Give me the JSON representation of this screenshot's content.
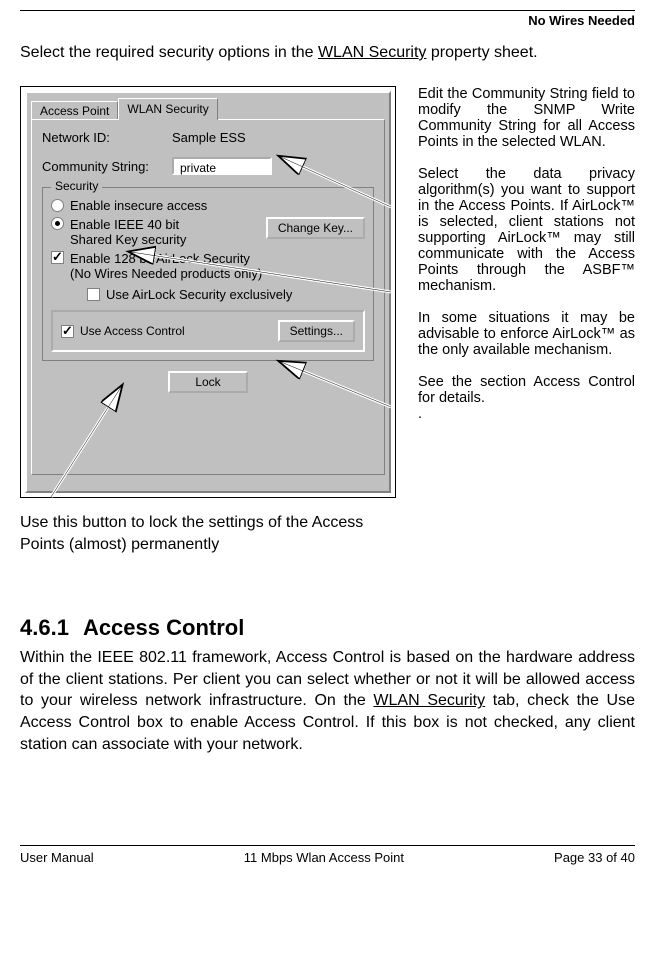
{
  "header": "No Wires Needed",
  "intro_before": "Select the required security options in the ",
  "intro_link": "WLAN Security",
  "intro_after": " property sheet.",
  "dialog": {
    "tab_inactive": "Access Point",
    "tab_active": "WLAN Security",
    "network_id_label": "Network ID:",
    "network_id_value": "Sample ESS",
    "community_label": "Community String:",
    "community_value": "private",
    "security_legend": "Security",
    "opt_insecure": "Enable insecure access",
    "opt_ieee_line1": "Enable IEEE 40 bit",
    "opt_ieee_line2": "Shared Key security",
    "change_key_btn": "Change Key...",
    "opt_airlock_line1": "Enable 128 bit AirLock Security",
    "opt_airlock_line2": "(No Wires Needed products only)",
    "opt_exclusive": "Use AirLock Security exclusively",
    "opt_access_control": "Use Access Control",
    "settings_btn": "Settings...",
    "lock_btn": "Lock"
  },
  "caption": "Use this button to lock the settings of the Access Points (almost) permanently",
  "side": {
    "p1": "Edit the Community String field to modify the SNMP Write Community String for all Access Points in the selected WLAN.",
    "p2": "Select the data privacy algorithm(s) you want to support in the Access Points. If AirLock™ is selected, client stations not supporting AirLock™ may still communicate with the Access Points through the ASBF™ mechanism.",
    "p3": "In some situations it may be advisable to enforce AirLock™ as the only available mechanism.",
    "p4": "See the section Access Control for details.",
    "p5": "."
  },
  "section": {
    "num": "4.6.1",
    "title": "Access Control",
    "para_before": "Within the IEEE 802.11 framework, Access Control is based on the hardware address of the client stations. Per client you can select whether or not it will be allowed access to your wireless network infrastructure. On the ",
    "para_link": "WLAN Security",
    "para_after": " tab, check the Use Access Control box to enable Access Control. If this box is not checked, any client station can associate with your network."
  },
  "footer": {
    "left": "User Manual",
    "center": "11 Mbps Wlan Access Point",
    "right": "Page 33 of 40"
  }
}
